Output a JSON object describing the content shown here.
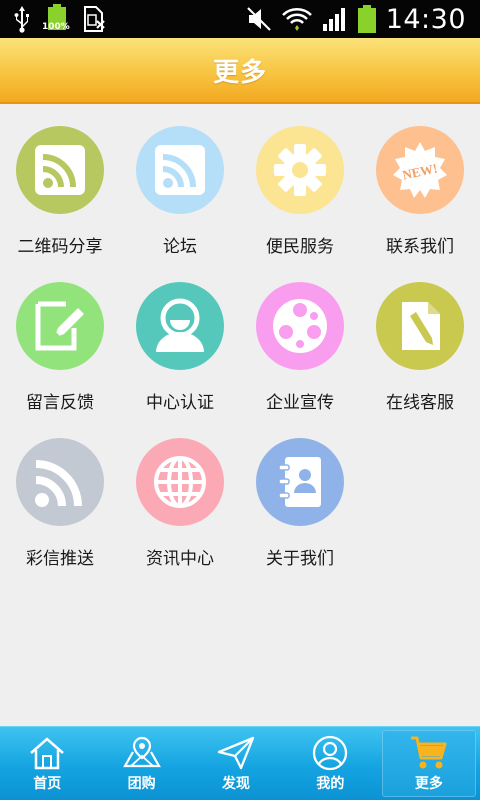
{
  "status_bar": {
    "time": "14:30",
    "battery_percent": "100%",
    "icons": [
      "usb-icon",
      "battery-full-icon",
      "sim-card-icon",
      "mute-icon",
      "wifi-icon",
      "signal-icon",
      "battery-icon"
    ]
  },
  "header": {
    "title": "更多"
  },
  "grid": {
    "items": [
      {
        "label": "二维码分享",
        "icon": "rss-icon",
        "color": "#b6c85f"
      },
      {
        "label": "论坛",
        "icon": "rss-icon",
        "color": "#b5def8"
      },
      {
        "label": "便民服务",
        "icon": "gear-icon",
        "color": "#fbe492"
      },
      {
        "label": "联系我们",
        "icon": "new-badge-icon",
        "color": "#fdc08e",
        "badge_text": "NEW!"
      },
      {
        "label": "留言反馈",
        "icon": "pencil-edit-icon",
        "color": "#93e37c"
      },
      {
        "label": "中心认证",
        "icon": "user-icon",
        "color": "#55c8bb"
      },
      {
        "label": "企业宣传",
        "icon": "film-reel-icon",
        "color": "#f99eef"
      },
      {
        "label": "在线客服",
        "icon": "document-pencil-icon",
        "color": "#c9c84f"
      },
      {
        "label": "彩信推送",
        "icon": "rss-icon",
        "color": "#c2c9d2"
      },
      {
        "label": "资讯中心",
        "icon": "globe-icon",
        "color": "#fca9b6"
      },
      {
        "label": "关于我们",
        "icon": "contact-book-icon",
        "color": "#8fb3e8"
      }
    ]
  },
  "bottom_nav": {
    "items": [
      {
        "label": "首页",
        "icon": "home-icon"
      },
      {
        "label": "团购",
        "icon": "map-location-icon"
      },
      {
        "label": "发现",
        "icon": "paper-plane-icon"
      },
      {
        "label": "我的",
        "icon": "user-circle-icon"
      },
      {
        "label": "更多",
        "icon": "shopping-cart-icon",
        "active": true
      }
    ]
  }
}
